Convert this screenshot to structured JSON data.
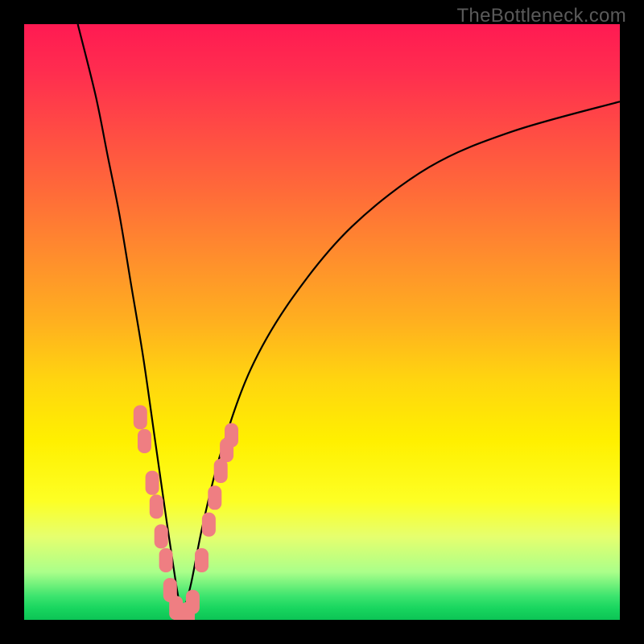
{
  "watermark": "TheBottleneck.com",
  "colors": {
    "frame": "#000000",
    "curve": "#000000",
    "marker": "#ef7e82",
    "gradient_top": "#ff1a52",
    "gradient_bottom": "#0cc455"
  },
  "chart_data": {
    "type": "line",
    "title": "",
    "xlabel": "",
    "ylabel": "",
    "xlim": [
      0,
      100
    ],
    "ylim": [
      0,
      100
    ],
    "grid": false,
    "description": "Bottleneck performance chart: gradient red-to-green from top to bottom; a V-shaped black curve whose minimum touches the green band at roughly x ≈ 26; pink/coral rounded-rectangle markers highlight data points on both flanks of the valley near the bottom.",
    "series": [
      {
        "name": "left-curve",
        "values": [
          {
            "x": 9,
            "y": 100
          },
          {
            "x": 12,
            "y": 88
          },
          {
            "x": 14,
            "y": 78
          },
          {
            "x": 16,
            "y": 68
          },
          {
            "x": 18,
            "y": 56
          },
          {
            "x": 20,
            "y": 44
          },
          {
            "x": 22,
            "y": 30
          },
          {
            "x": 24,
            "y": 16
          },
          {
            "x": 25.5,
            "y": 6
          },
          {
            "x": 26.5,
            "y": 0.5
          }
        ]
      },
      {
        "name": "right-curve",
        "values": [
          {
            "x": 26.5,
            "y": 0.5
          },
          {
            "x": 28,
            "y": 6
          },
          {
            "x": 30,
            "y": 16
          },
          {
            "x": 33,
            "y": 28
          },
          {
            "x": 38,
            "y": 42
          },
          {
            "x": 45,
            "y": 54
          },
          {
            "x": 55,
            "y": 66
          },
          {
            "x": 68,
            "y": 76
          },
          {
            "x": 82,
            "y": 82
          },
          {
            "x": 100,
            "y": 87
          }
        ]
      }
    ],
    "markers": [
      {
        "x": 19.5,
        "y": 34
      },
      {
        "x": 20.2,
        "y": 30
      },
      {
        "x": 21.5,
        "y": 23
      },
      {
        "x": 22.2,
        "y": 19
      },
      {
        "x": 23.0,
        "y": 14
      },
      {
        "x": 23.8,
        "y": 10
      },
      {
        "x": 24.5,
        "y": 5
      },
      {
        "x": 25.5,
        "y": 2
      },
      {
        "x": 26.5,
        "y": 0.8
      },
      {
        "x": 27.5,
        "y": 1
      },
      {
        "x": 28.3,
        "y": 3
      },
      {
        "x": 29.8,
        "y": 10
      },
      {
        "x": 31.0,
        "y": 16
      },
      {
        "x": 32.0,
        "y": 20.5
      },
      {
        "x": 33.0,
        "y": 25
      },
      {
        "x": 34.0,
        "y": 28.5
      },
      {
        "x": 34.8,
        "y": 31
      }
    ]
  }
}
